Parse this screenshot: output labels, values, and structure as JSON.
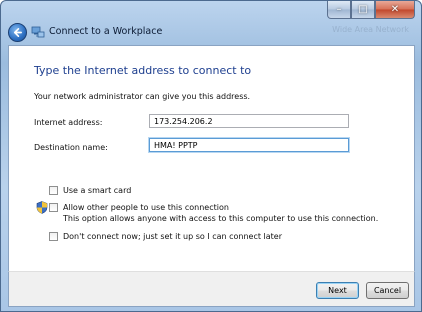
{
  "window": {
    "title": "Connect to a Workplace",
    "ghost_text": "Wide Area Network",
    "controls": {
      "minimize": "–",
      "maximize": "□",
      "close": "✕"
    }
  },
  "page": {
    "heading": "Type the Internet address to connect to",
    "subtext": "Your network administrator can give you this address."
  },
  "form": {
    "internet_address_label": "Internet address:",
    "internet_address_value": "173.254.206.2",
    "destination_name_label": "Destination name:",
    "destination_name_value": "HMA! PPTP"
  },
  "options": {
    "smart_card": {
      "label": "Use a smart card",
      "checked": false
    },
    "allow_others": {
      "label": "Allow other people to use this connection",
      "description": "This option allows anyone with access to this computer to use this connection.",
      "checked": false
    },
    "dont_connect": {
      "label": "Don't connect now; just set it up so I can connect later",
      "checked": false
    }
  },
  "buttons": {
    "next": "Next",
    "cancel": "Cancel"
  },
  "icons": {
    "back": "back-arrow-icon",
    "network": "network-connection-icon",
    "shield": "uac-shield-icon"
  },
  "colors": {
    "heading": "#1e3f8f",
    "accent": "#3c7fb1"
  }
}
